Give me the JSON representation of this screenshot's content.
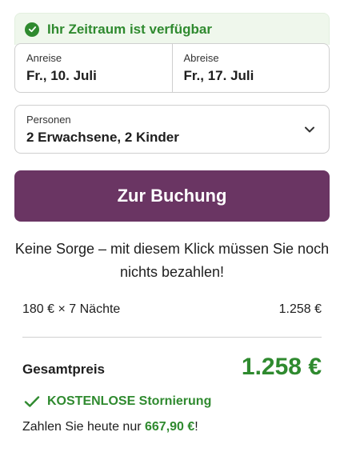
{
  "availability": {
    "text": "Ihr Zeitraum ist verfügbar",
    "icon": "check-circle-icon",
    "color": "#2f8a2f"
  },
  "arrival": {
    "label": "Anreise",
    "value": "Fr., 10. Juli"
  },
  "departure": {
    "label": "Abreise",
    "value": "Fr., 17. Juli"
  },
  "persons": {
    "label": "Personen",
    "value": "2 Erwachsene, 2 Kinder",
    "icon": "chevron-down-icon"
  },
  "book_button": {
    "label": "Zur Buchung",
    "color": "#6a3563"
  },
  "no_worry_text": "Keine Sorge – mit diesem Klick müssen Sie noch nichts bezahlen!",
  "price_breakdown": {
    "label": "180 € × 7 Nächte",
    "value": "1.258 €"
  },
  "total": {
    "label": "Gesamtpreis",
    "value": "1.258 €"
  },
  "cancellation": {
    "text": "KOSTENLOSE Stornierung",
    "icon": "check-icon"
  },
  "pay_today": {
    "prefix": "Zahlen Sie heute nur ",
    "amount": "667,90 €",
    "suffix": "!"
  }
}
